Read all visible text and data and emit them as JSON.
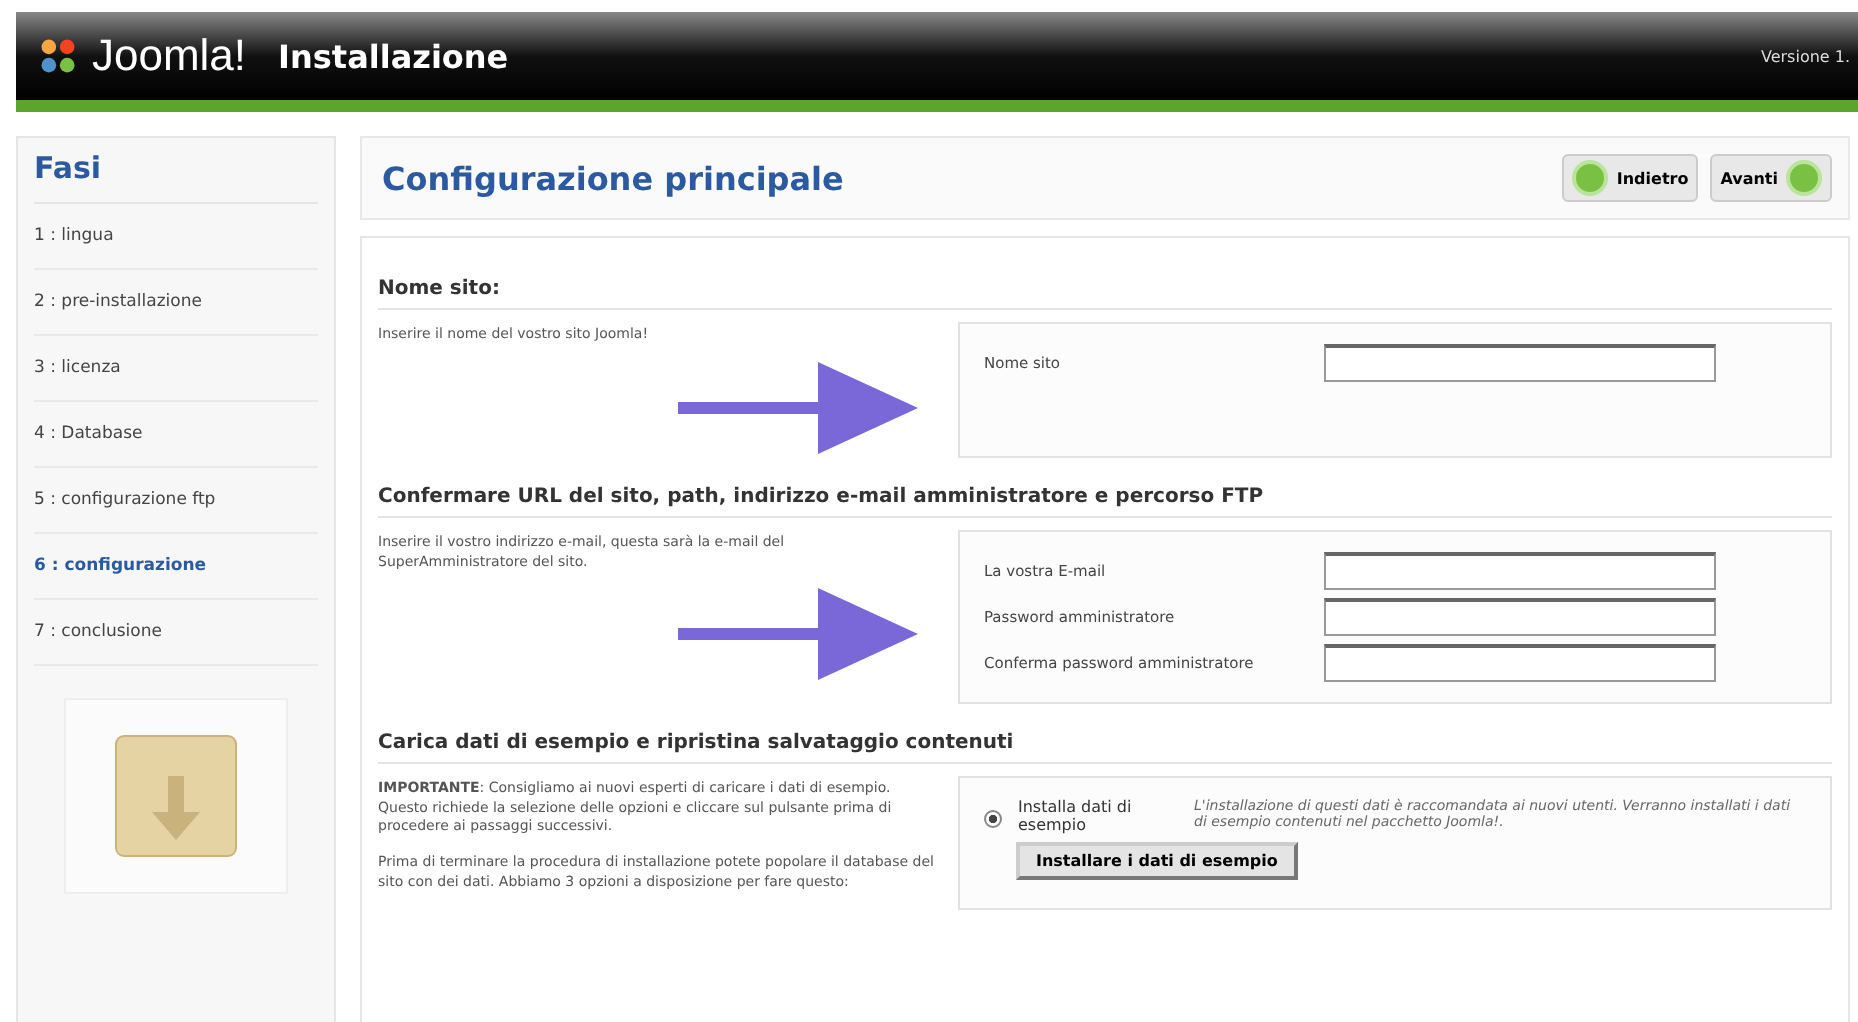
{
  "header": {
    "logo": "Joomla!",
    "title": "Installazione",
    "version": "Versione 1."
  },
  "sidebar": {
    "title": "Fasi",
    "items": [
      {
        "label": "1 : lingua",
        "selected": false
      },
      {
        "label": "2 : pre-installazione",
        "selected": false
      },
      {
        "label": "3 : licenza",
        "selected": false
      },
      {
        "label": "4 : Database",
        "selected": false
      },
      {
        "label": "5 : configurazione ftp",
        "selected": false
      },
      {
        "label": "6 : configurazione",
        "selected": true
      },
      {
        "label": "7 : conclusione",
        "selected": false
      }
    ]
  },
  "main": {
    "title": "Configurazione principale",
    "buttons": [
      {
        "label": "Indietro",
        "kind": "back"
      },
      {
        "label": "Avanti",
        "kind": "next"
      }
    ]
  },
  "sections": [
    {
      "heading": "Nome sito:",
      "description": [
        "Inserire il nome del vostro sito Joomla!"
      ],
      "arrow": true,
      "fields": [
        {
          "label": "Nome sito"
        }
      ]
    },
    {
      "heading": "Confermare URL del sito, path, indirizzo e-mail amministratore e percorso FTP",
      "description": [
        "Inserire il vostro indirizzo e-mail, questa sarà la e-mail del SuperAmministratore del sito."
      ],
      "arrow": true,
      "fields": [
        {
          "label": "La vostra E-mail"
        },
        {
          "label": "Password amministratore"
        },
        {
          "label": "Conferma password amministratore"
        }
      ]
    },
    {
      "heading": "Carica dati di esempio e ripristina salvataggio contenuti",
      "description": [
        "**IMPORTANTE**: Consigliamo ai nuovi esperti di caricare i dati di esempio. Questo richiede la selezione delle opzioni e cliccare sul pulsante prima di procedere ai passaggi successivi.",
        "Prima di terminare la procedura di installazione potete popolare il database del sito con dei dati. Abbiamo 3 opzioni a disposizione per fare questo:"
      ],
      "arrow": false,
      "options": [
        {
          "label": "Installa dati di esempio",
          "selected": true,
          "note": "L'installazione di questi dati è raccomandata ai nuovi utenti. Verranno installati i dati di esempio contenuti nel pacchetto Joomla!.",
          "button": "Installare i dati di esempio"
        }
      ]
    }
  ]
}
